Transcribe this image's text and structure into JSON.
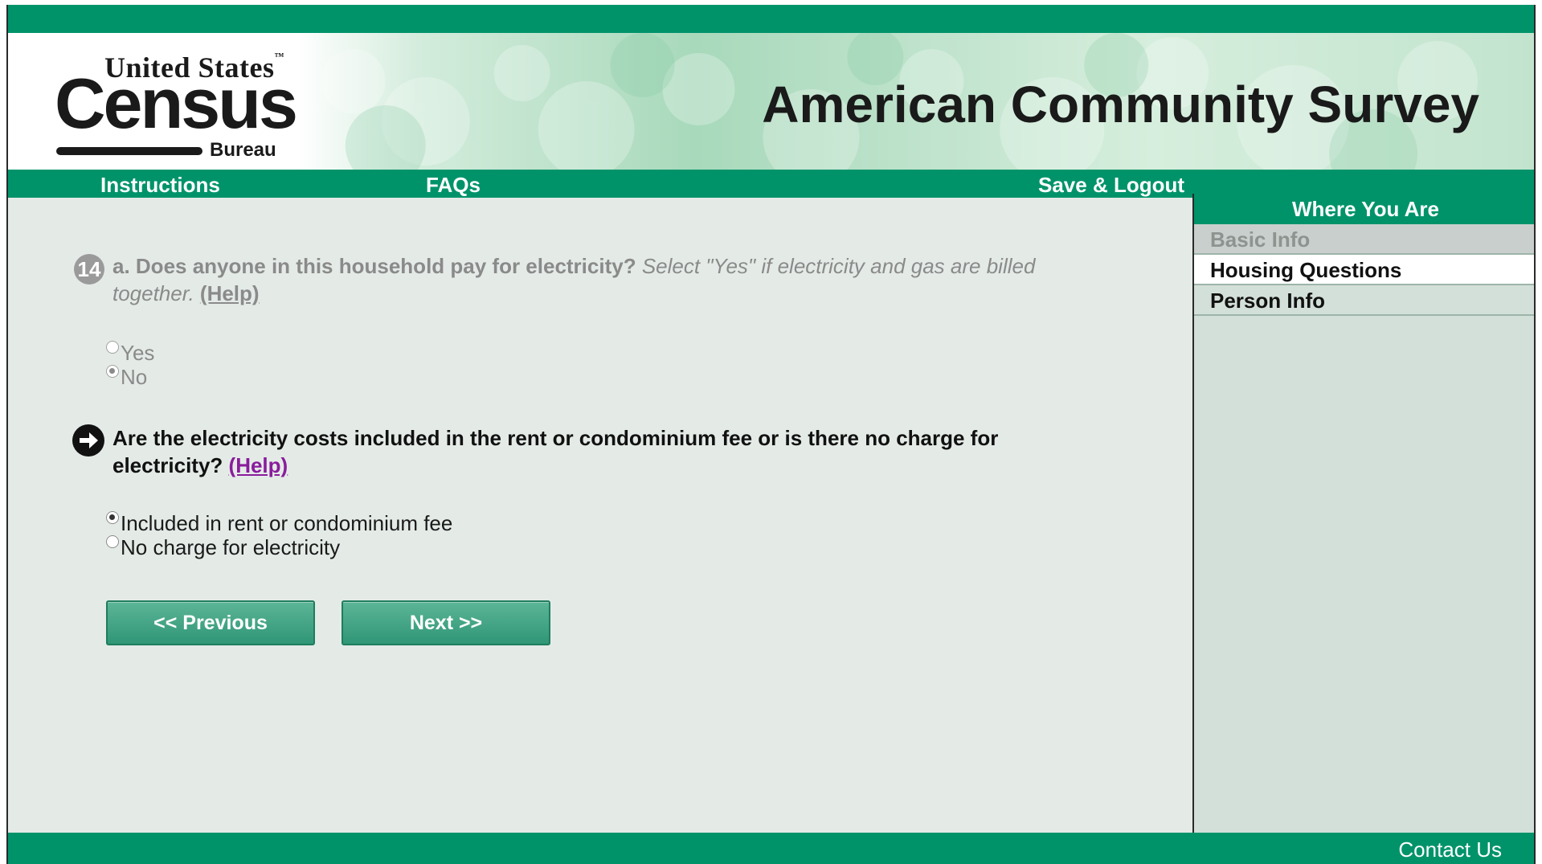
{
  "header": {
    "logo": {
      "line1": "United States",
      "tm": "™",
      "census": "Census",
      "bureau": "Bureau"
    },
    "title": "American Community Survey"
  },
  "nav": {
    "instructions": "Instructions",
    "faqs": "FAQs",
    "save_logout": "Save & Logout"
  },
  "question_prev": {
    "number": "14",
    "bold_text": "a. Does anyone in this household pay for electricity?",
    "italic_text": " Select \"Yes\" if electricity and gas are billed together.",
    "help": "(Help)",
    "options": [
      {
        "label": "Yes",
        "selected": false
      },
      {
        "label": "No",
        "selected": true
      }
    ]
  },
  "question_current": {
    "text": "Are the electricity costs included in the rent or condominium fee or is there no charge for electricity?",
    "help": "(Help)",
    "options": [
      {
        "label": "Included in rent or condominium fee",
        "selected": true
      },
      {
        "label": "No charge for electricity",
        "selected": false
      }
    ]
  },
  "buttons": {
    "previous": "<<   Previous",
    "next": "Next   >>"
  },
  "sidebar": {
    "heading": "Where You Are",
    "items": [
      {
        "label": "Basic Info",
        "state": "done"
      },
      {
        "label": "Housing Questions",
        "state": "current"
      },
      {
        "label": "Person Info",
        "state": "todo"
      }
    ]
  },
  "footer": {
    "contact": "Contact Us"
  },
  "colors": {
    "brand_green": "#00936a",
    "help_link_purple": "#8a1c9c"
  }
}
